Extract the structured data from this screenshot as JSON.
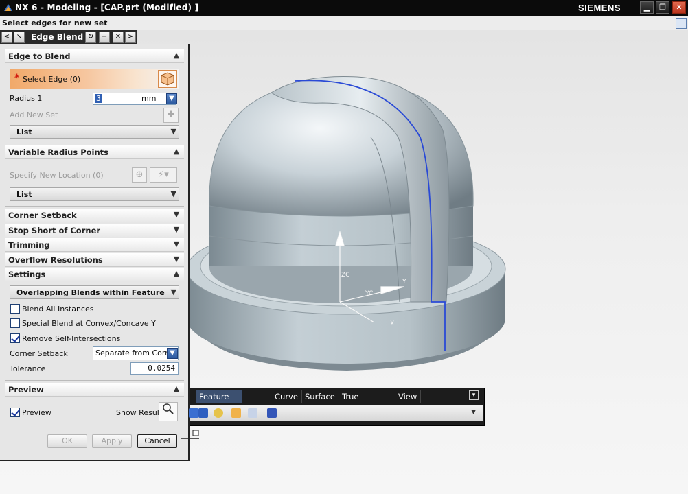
{
  "window": {
    "title": "NX 6 - Modeling - [CAP.prt (Modified) ]",
    "brand": "SIEMENS",
    "minimize": "▁",
    "restore": "❐",
    "close": "✕"
  },
  "cue": "Select edges for new set",
  "dialog_tab": {
    "title": "Edge Blend",
    "back": "<",
    "forward": ">",
    "reset": "↻",
    "collapse": "−",
    "close": "✕"
  },
  "edge_to_blend": {
    "header": "Edge to Blend",
    "select_edge": "Select Edge (0)",
    "radius_label": "Radius 1",
    "radius_value": "3",
    "radius_unit": "mm",
    "add_new_set": "Add New Set",
    "list_label": "List"
  },
  "variable_radius": {
    "header": "Variable Radius Points",
    "specify_location": "Specify New Location (0)",
    "list_label": "List"
  },
  "collapsed_groups": {
    "corner_setback": "Corner Setback",
    "stop_short": "Stop Short of Corner",
    "trimming": "Trimming",
    "overflow": "Overflow Resolutions"
  },
  "settings": {
    "header": "Settings",
    "overlap_label": "Overlapping Blends within Feature",
    "blend_all": {
      "label": "Blend All Instances",
      "checked": false
    },
    "special_blend": {
      "label": "Special Blend at Convex/Concave Y",
      "checked": false
    },
    "remove_self": {
      "label": "Remove Self-Intersections",
      "checked": true
    },
    "corner_setback_label": "Corner Setback",
    "corner_setback_value": "Separate from Corner",
    "tolerance_label": "Tolerance",
    "tolerance_value": "0.0254"
  },
  "preview": {
    "header": "Preview",
    "preview_label": "Preview",
    "preview_checked": true,
    "show_result": "Show Result"
  },
  "buttons": {
    "ok": "OK",
    "apply": "Apply",
    "cancel": "Cancel"
  },
  "toolbar": {
    "tabs": [
      "Feature Operation",
      "Curve",
      "Surface",
      "True Shading",
      "View"
    ],
    "active_tab": "Feature Operation"
  },
  "viewport": {
    "csys_labels": {
      "z": "ZC",
      "y": "Y",
      "yc": "YC",
      "x": "X"
    }
  },
  "colors": {
    "selection_highlight": "#f1a96a",
    "edge_highlight": "#2a4ad6",
    "title_bar": "#0b0b0b",
    "active_tab": "#3c5070"
  }
}
